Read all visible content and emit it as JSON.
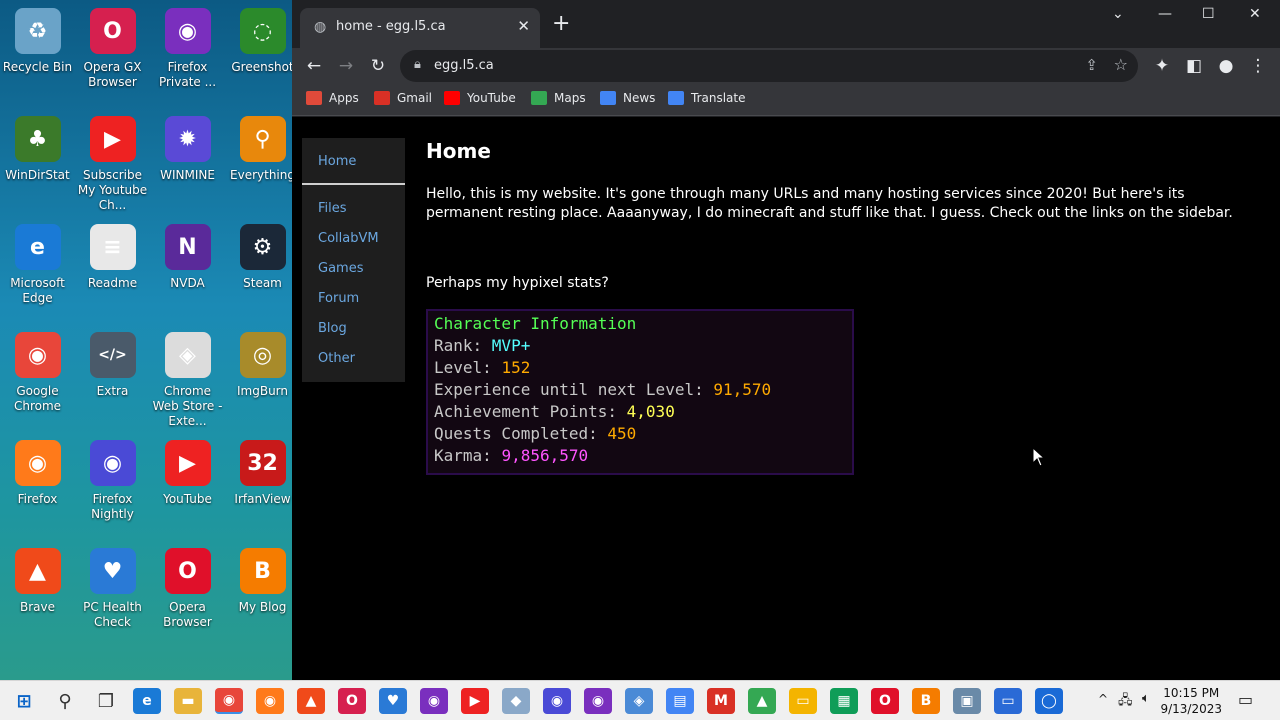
{
  "desktop": {
    "icons": [
      {
        "label": "Recycle Bin",
        "icon": "recycle-bin-icon",
        "glyph": "♻",
        "color": "#6aa3c8"
      },
      {
        "label": "Opera GX Browser",
        "icon": "opera-gx-icon",
        "glyph": "O",
        "color": "#d6204f"
      },
      {
        "label": "Firefox Private ...",
        "icon": "firefox-private-icon",
        "glyph": "◉",
        "color": "#7a2fbe"
      },
      {
        "label": "Greenshot",
        "icon": "greenshot-icon",
        "glyph": "◌",
        "color": "#2b8a2b"
      },
      {
        "label": "WinDirStat",
        "icon": "tree-icon",
        "glyph": "♣",
        "color": "#3b7a2a"
      },
      {
        "label": "Subscribe My Youtube Ch...",
        "icon": "youtube-icon",
        "glyph": "▶",
        "color": "#e22"
      },
      {
        "label": "WINMINE",
        "icon": "mine-icon",
        "glyph": "✹",
        "color": "#5a4ad6"
      },
      {
        "label": "Everything",
        "icon": "magnifier-icon",
        "glyph": "⚲",
        "color": "#e8880c"
      },
      {
        "label": "Microsoft Edge",
        "icon": "edge-icon",
        "glyph": "e",
        "color": "#1a7ad6"
      },
      {
        "label": "Readme",
        "icon": "document-icon",
        "glyph": "≡",
        "color": "#e8e8e8"
      },
      {
        "label": "NVDA",
        "icon": "nvda-icon",
        "glyph": "N",
        "color": "#5a2a9a"
      },
      {
        "label": "Steam",
        "icon": "steam-icon",
        "glyph": "⚙",
        "color": "#1b2838"
      },
      {
        "label": "Google Chrome",
        "icon": "chrome-icon",
        "glyph": "◉",
        "color": "#e8463a"
      },
      {
        "label": "Extra",
        "icon": "code-icon",
        "glyph": "</>",
        "color": "#4a5a6a"
      },
      {
        "label": "Chrome Web Store - Exte...",
        "icon": "web-store-icon",
        "glyph": "◈",
        "color": "#dcdcdc"
      },
      {
        "label": "ImgBurn",
        "icon": "disc-icon",
        "glyph": "◎",
        "color": "#a88b2a"
      },
      {
        "label": "Firefox",
        "icon": "firefox-icon",
        "glyph": "◉",
        "color": "#ff7a1a"
      },
      {
        "label": "Firefox Nightly",
        "icon": "firefox-nightly-icon",
        "glyph": "◉",
        "color": "#4a4ad6"
      },
      {
        "label": "YouTube",
        "icon": "youtube-icon",
        "glyph": "▶",
        "color": "#e22"
      },
      {
        "label": "IrfanView",
        "icon": "irfanview-icon",
        "glyph": "32",
        "color": "#c81a1a"
      },
      {
        "label": "Brave",
        "icon": "brave-icon",
        "glyph": "▲",
        "color": "#f04a1a"
      },
      {
        "label": "PC Health Check",
        "icon": "heart-icon",
        "glyph": "♥",
        "color": "#2a7ad6"
      },
      {
        "label": "Opera Browser",
        "icon": "opera-icon",
        "glyph": "O",
        "color": "#e0102a"
      },
      {
        "label": "My Blog",
        "icon": "blogger-icon",
        "glyph": "B",
        "color": "#f57c00"
      }
    ]
  },
  "browser": {
    "tab_title": "home - egg.l5.ca",
    "tab_close": "✕",
    "new_tab": "+",
    "window_controls": {
      "minimize": "—",
      "maximize": "☐",
      "close": "✕",
      "tabsearch": "⌄"
    },
    "url": "egg.l5.ca",
    "bookmarks": [
      {
        "label": "Apps",
        "icon": "apps-icon",
        "color": "#e04a3a"
      },
      {
        "label": "Gmail",
        "icon": "gmail-icon",
        "color": "#d93025"
      },
      {
        "label": "YouTube",
        "icon": "youtube-icon",
        "color": "#ff0000"
      },
      {
        "label": "Maps",
        "icon": "maps-icon",
        "color": "#34a853"
      },
      {
        "label": "News",
        "icon": "news-icon",
        "color": "#4285f4"
      },
      {
        "label": "Translate",
        "icon": "translate-icon",
        "color": "#4285f4"
      }
    ]
  },
  "page": {
    "nav": [
      "Home",
      "Files",
      "CollabVM",
      "Games",
      "Forum",
      "Blog",
      "Other"
    ],
    "heading": "Home",
    "intro": "Hello, this is my website. It's gone through many URLs and many hosting services since 2020! But here's its permanent resting place. Aaaanyway, I do minecraft and stuff like that. I guess. Check out the links on the sidebar.",
    "perhaps": "Perhaps my hypixel stats?",
    "stats": {
      "title": "Character Information",
      "rows": [
        {
          "label": "Rank: ",
          "value": "MVP+",
          "color": "#55ffff"
        },
        {
          "label": "Level: ",
          "value": "152",
          "color": "#ffaa00"
        },
        {
          "label": "Experience until next Level: ",
          "value": "91,570",
          "color": "#ffaa00"
        },
        {
          "label": "Achievement Points: ",
          "value": "4,030",
          "color": "#ffff55"
        },
        {
          "label": "Quests Completed: ",
          "value": "450",
          "color": "#ffaa00"
        },
        {
          "label": "Karma: ",
          "value": "9,856,570",
          "color": "#ff55ff"
        }
      ]
    }
  },
  "taskbar": {
    "time": "10:15 PM",
    "date": "9/13/2023",
    "apps": [
      {
        "icon": "start-icon",
        "glyph": "⊞",
        "color": "#0a64c8"
      },
      {
        "icon": "search-icon",
        "glyph": "⚲",
        "color": "#333"
      },
      {
        "icon": "task-view-icon",
        "glyph": "❐",
        "color": "#333"
      },
      {
        "icon": "edge-icon",
        "glyph": "e",
        "color": "#1a7ad6"
      },
      {
        "icon": "folder-icon",
        "glyph": "▬",
        "color": "#e8b43a"
      },
      {
        "icon": "chrome-icon",
        "glyph": "◉",
        "color": "#e8463a"
      },
      {
        "icon": "firefox-icon",
        "glyph": "◉",
        "color": "#ff7a1a"
      },
      {
        "icon": "brave-icon",
        "glyph": "▲",
        "color": "#f04a1a"
      },
      {
        "icon": "opera-gx-icon",
        "glyph": "O",
        "color": "#d6204f"
      },
      {
        "icon": "heart-icon",
        "glyph": "♥",
        "color": "#2a7ad6"
      },
      {
        "icon": "firefox-private-icon",
        "glyph": "◉",
        "color": "#7a2fbe"
      },
      {
        "icon": "youtube-icon",
        "glyph": "▶",
        "color": "#e22"
      },
      {
        "icon": "drop-icon",
        "glyph": "◆",
        "color": "#8aa8c8"
      },
      {
        "icon": "firefox-nightly-icon",
        "glyph": "◉",
        "color": "#4a4ad6"
      },
      {
        "icon": "firefox-private-icon",
        "glyph": "◉",
        "color": "#7a2fbe"
      },
      {
        "icon": "store-icon",
        "glyph": "◈",
        "color": "#4a8ad6"
      },
      {
        "icon": "docs-icon",
        "glyph": "▤",
        "color": "#4285f4"
      },
      {
        "icon": "gmail-icon",
        "glyph": "M",
        "color": "#d93025"
      },
      {
        "icon": "drive-icon",
        "glyph": "▲",
        "color": "#34a853"
      },
      {
        "icon": "slides-icon",
        "glyph": "▭",
        "color": "#f4b400"
      },
      {
        "icon": "sheets-icon",
        "glyph": "▦",
        "color": "#0f9d58"
      },
      {
        "icon": "opera-icon",
        "glyph": "O",
        "color": "#e0102a"
      },
      {
        "icon": "blogger-icon",
        "glyph": "B",
        "color": "#f57c00"
      },
      {
        "icon": "image-icon",
        "glyph": "▣",
        "color": "#6a8aa8"
      },
      {
        "icon": "window-icon",
        "glyph": "▭",
        "color": "#2a6ad6"
      },
      {
        "icon": "cortana-icon",
        "glyph": "◯",
        "color": "#1a6ad6"
      }
    ]
  }
}
